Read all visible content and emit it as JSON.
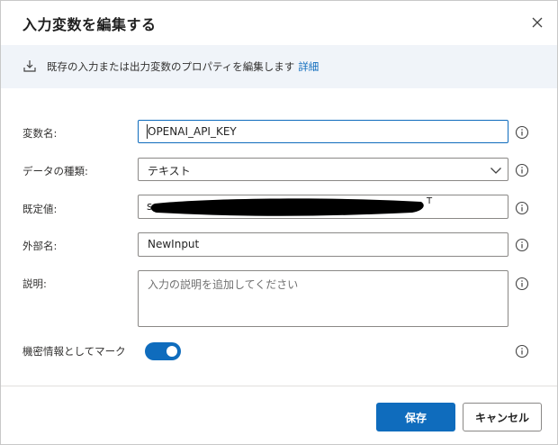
{
  "dialog": {
    "title": "入力変数を編集する",
    "close_icon": "close-icon"
  },
  "banner": {
    "icon": "import-icon",
    "text": "既存の入力または出力変数のプロパティを編集します",
    "link": "詳細"
  },
  "form": {
    "variable_name": {
      "label": "変数名:",
      "value": "OPENAI_API_KEY"
    },
    "data_type": {
      "label": "データの種類:",
      "value": "テキスト"
    },
    "default_value": {
      "label": "既定値:",
      "value_prefix": "s",
      "value_suffix": "T"
    },
    "external_name": {
      "label": "外部名:",
      "value": "NewInput"
    },
    "description": {
      "label": "説明:",
      "placeholder": "入力の説明を追加してください"
    },
    "sensitive": {
      "label": "機密情報としてマーク",
      "checked": true
    }
  },
  "buttons": {
    "save": "保存",
    "cancel": "キャンセル"
  },
  "colors": {
    "accent": "#0f6cbd",
    "banner_bg": "#f0f4f9",
    "border": "#8a8886"
  }
}
